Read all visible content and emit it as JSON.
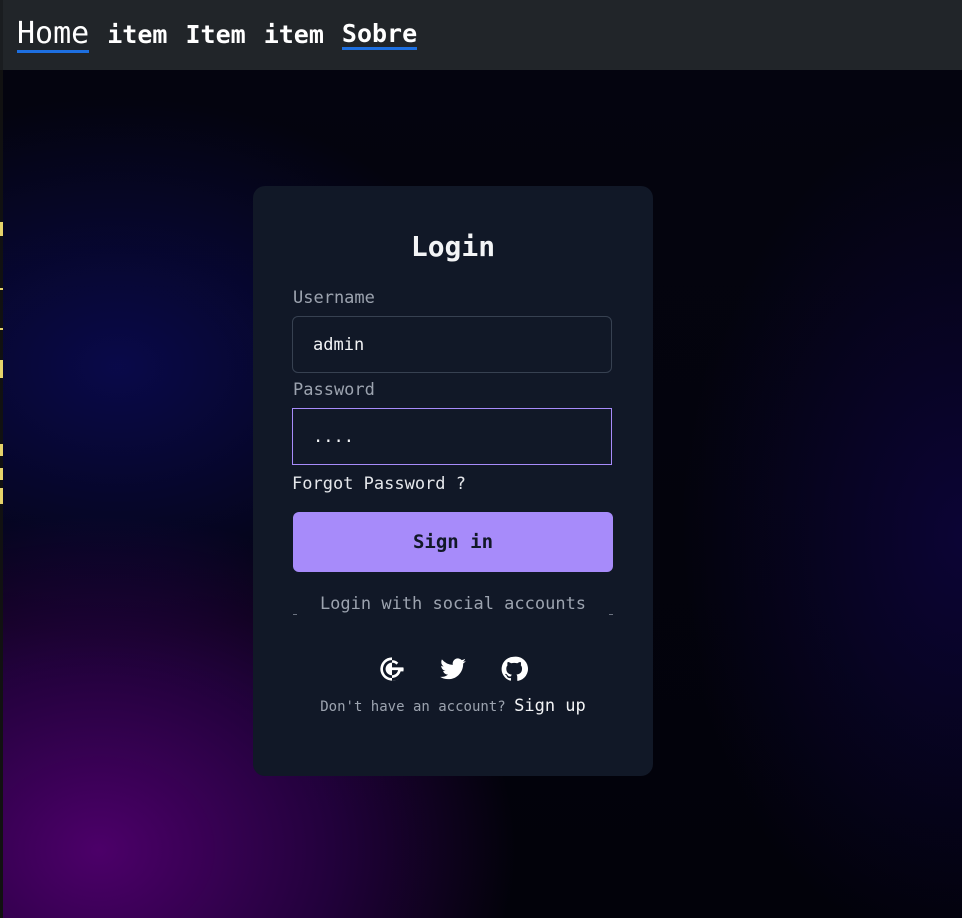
{
  "nav": {
    "items": [
      {
        "label": "Home"
      },
      {
        "label": "item"
      },
      {
        "label": "Item"
      },
      {
        "label": "item"
      },
      {
        "label": "Sobre"
      }
    ]
  },
  "login": {
    "title": "Login",
    "username_label": "Username",
    "username_value": "admin",
    "password_label": "Password",
    "password_value": "....",
    "forgot_label": "Forgot Password ?",
    "signin_label": "Sign in",
    "social_text": "Login with social accounts",
    "social_icons": [
      "google-icon",
      "twitter-icon",
      "github-icon"
    ],
    "no_account_text": "Don't have an account?",
    "signup_label": "Sign up"
  },
  "colors": {
    "accent": "#a78bfa",
    "card_bg": "#111827",
    "navbar_bg": "#212529",
    "nav_underline": "#1d6fe0"
  }
}
